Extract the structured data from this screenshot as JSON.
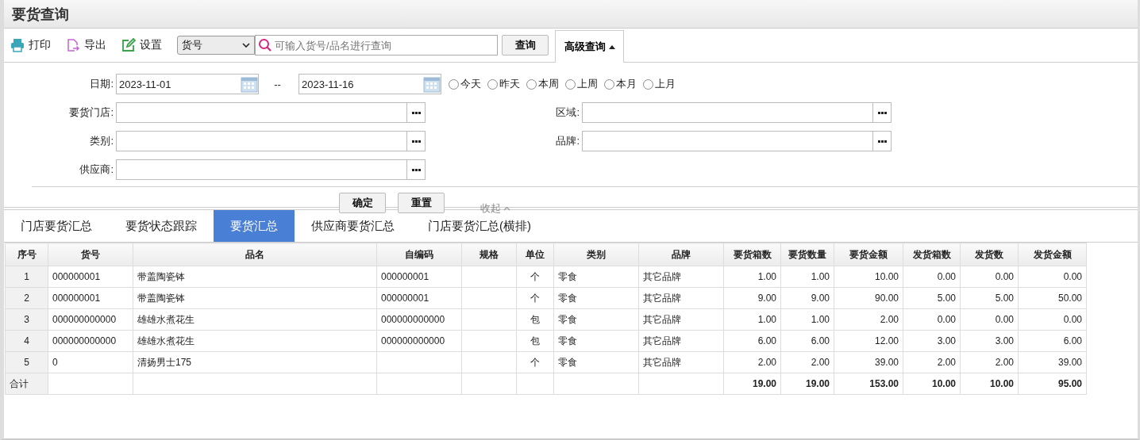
{
  "title": "要货查询",
  "toolbar": [
    {
      "kind": "print",
      "label": "打印"
    },
    {
      "kind": "export",
      "label": "导出"
    },
    {
      "kind": "settings",
      "label": "设置"
    }
  ],
  "search": {
    "select": "货号",
    "placeholder": "可输入货号/品名进行查询",
    "button": "查询"
  },
  "advanced_tab": {
    "label": "高级查询",
    "expanded": true
  },
  "date": {
    "label": "日期:",
    "from": "2023-11-01",
    "separator": "--",
    "to": "2023-11-16"
  },
  "quick_ranges": [
    {
      "label": "今天",
      "selected": false
    },
    {
      "label": "昨天",
      "selected": false
    },
    {
      "label": "本周",
      "selected": false
    },
    {
      "label": "上周",
      "selected": false
    },
    {
      "label": "本月",
      "selected": false
    },
    {
      "label": "上月",
      "selected": false
    }
  ],
  "field_rows": [
    [
      {
        "label": "要货门店:"
      },
      {
        "label": "区域:"
      }
    ],
    [
      {
        "label": "类别:"
      },
      {
        "label": "品牌:"
      }
    ],
    [
      {
        "label": "供应商:"
      }
    ]
  ],
  "actions": {
    "confirm": "确定",
    "reset": "重置",
    "collapse": "收起"
  },
  "tabs": [
    {
      "label": "门店要货汇总",
      "selected": false
    },
    {
      "label": "要货状态跟踪",
      "selected": false
    },
    {
      "label": "要货汇总",
      "selected": true
    },
    {
      "label": "供应商要货汇总",
      "selected": false
    },
    {
      "label": "门店要货汇总(横排)",
      "selected": false
    }
  ],
  "table": {
    "columns": [
      "序号",
      "货号",
      "品名",
      "自编码",
      "规格",
      "单位",
      "类别",
      "品牌",
      "要货箱数",
      "要货数量",
      "要货金额",
      "发货箱数",
      "发货数",
      "发货金额"
    ],
    "rows": [
      [
        "1",
        "000000001",
        "带盖陶瓷钵",
        "000000001",
        null,
        "个",
        "零食",
        "其它品牌",
        "1.00",
        "1.00",
        "10.00",
        "0.00",
        "0.00",
        "0.00"
      ],
      [
        "2",
        "000000001",
        "带盖陶瓷钵",
        "000000001",
        null,
        "个",
        "零食",
        "其它品牌",
        "9.00",
        "9.00",
        "90.00",
        "5.00",
        "5.00",
        "50.00"
      ],
      [
        "3",
        "000000000000",
        "雄雄水煮花生",
        "000000000000",
        null,
        "包",
        "零食",
        "其它品牌",
        "1.00",
        "1.00",
        "2.00",
        "0.00",
        "0.00",
        "0.00"
      ],
      [
        "4",
        "000000000000",
        "雄雄水煮花生",
        "000000000000",
        null,
        "包",
        "零食",
        "其它品牌",
        "6.00",
        "6.00",
        "12.00",
        "3.00",
        "3.00",
        "6.00"
      ],
      [
        "5",
        "0",
        "清扬男士175",
        null,
        null,
        "个",
        "零食",
        "其它品牌",
        "2.00",
        "2.00",
        "39.00",
        "2.00",
        "2.00",
        "39.00"
      ]
    ],
    "total": {
      "label": "合计",
      "values": [
        "19.00",
        "19.00",
        "153.00",
        "10.00",
        "10.00",
        "95.00"
      ]
    }
  }
}
